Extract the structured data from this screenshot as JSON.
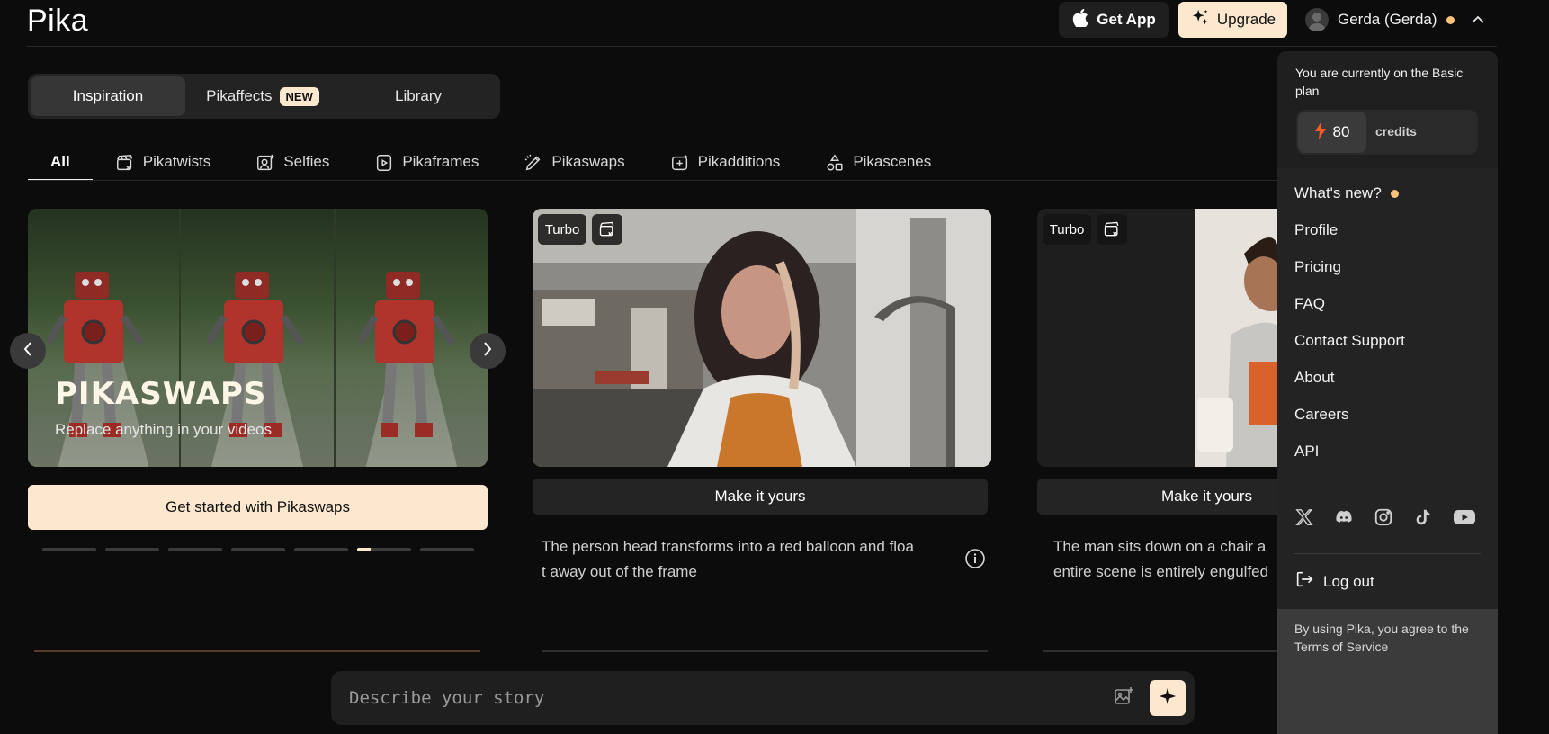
{
  "header": {
    "logo": "Pika",
    "get_app": "Get App",
    "upgrade": "Upgrade",
    "user_name": "Gerda (Gerda)"
  },
  "tabs": [
    {
      "label": "Inspiration",
      "active": true
    },
    {
      "label": "Pikaffects",
      "badge": "NEW"
    },
    {
      "label": "Library"
    }
  ],
  "categories": [
    {
      "label": "All",
      "icon": "none",
      "active": true
    },
    {
      "label": "Pikatwists",
      "icon": "clapper-icon"
    },
    {
      "label": "Selfies",
      "icon": "selfie-icon"
    },
    {
      "label": "Pikaframes",
      "icon": "frames-icon"
    },
    {
      "label": "Pikaswaps",
      "icon": "brush-icon"
    },
    {
      "label": "Pikadditions",
      "icon": "add-icon"
    },
    {
      "label": "Pikascenes",
      "icon": "shapes-icon"
    }
  ],
  "hero": {
    "title": "PIKASWAPS",
    "subtitle": "Replace anything in your videos",
    "cta": "Get started with Pikaswaps",
    "slides": 7,
    "active_slide": 5,
    "active_fill": 0.25
  },
  "cards": [
    {
      "badge": "Turbo",
      "button": "Make it yours",
      "prompt_line1": "The person head transforms into a red balloon and floa",
      "prompt_line2": "t away out of the frame"
    },
    {
      "badge": "Turbo",
      "button": "Make it yours",
      "prompt_line1": "The man sits down on a chair a",
      "prompt_line2": "entire scene is entirely engulfed"
    }
  ],
  "composer": {
    "placeholder": "Describe your story"
  },
  "menu": {
    "plan_text": "You are currently on the Basic plan",
    "credits_value": "80",
    "credits_label": "credits",
    "items": [
      "What's new?",
      "Profile",
      "Pricing",
      "FAQ",
      "Contact Support",
      "About",
      "Careers",
      "API"
    ],
    "logout": "Log out",
    "footer": "By using Pika, you agree to the Terms of Service"
  },
  "colors": {
    "accent": "#fbe8ce",
    "background": "#0c0c0c",
    "notify_dot": "#f8c27a"
  }
}
